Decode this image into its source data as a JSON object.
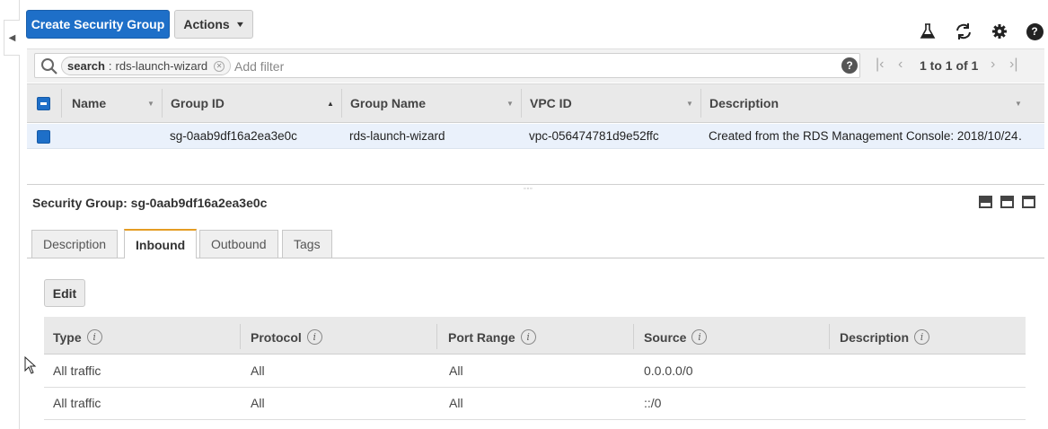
{
  "toolbar": {
    "create_label": "Create Security Group",
    "actions_label": "Actions",
    "icons": [
      "flask-icon",
      "refresh-icon",
      "gear-icon",
      "help-icon"
    ]
  },
  "filter": {
    "token_key": "search",
    "token_value": "rds-launch-wizard",
    "placeholder": "Add filter",
    "help_glyph": "?",
    "pager_text": "1 to 1 of 1"
  },
  "grid": {
    "columns": [
      "Name",
      "Group ID",
      "Group Name",
      "VPC ID",
      "Description"
    ],
    "rows": [
      {
        "name": "",
        "group_id": "sg-0aab9df16a2ea3e0c",
        "group_name": "rds-launch-wizard",
        "vpc_id": "vpc-056474781d9e52ffc",
        "description": "Created from the RDS Management Console: 2018/10/24…"
      }
    ]
  },
  "detail": {
    "title": "Security Group: sg-0aab9df16a2ea3e0c",
    "tabs": [
      "Description",
      "Inbound",
      "Outbound",
      "Tags"
    ],
    "active_tab": "Inbound",
    "edit_label": "Edit",
    "rule_columns": [
      "Type",
      "Protocol",
      "Port Range",
      "Source",
      "Description"
    ],
    "info_glyph": "i",
    "rules": [
      {
        "type": "All traffic",
        "protocol": "All",
        "port_range": "All",
        "source": "0.0.0.0/0",
        "description": ""
      },
      {
        "type": "All traffic",
        "protocol": "All",
        "port_range": "All",
        "source": "::/0",
        "description": ""
      }
    ]
  },
  "colors": {
    "primary": "#1e6fc8",
    "active_tab_accent": "#e59c23",
    "selected_row": "#eaf1fb"
  }
}
